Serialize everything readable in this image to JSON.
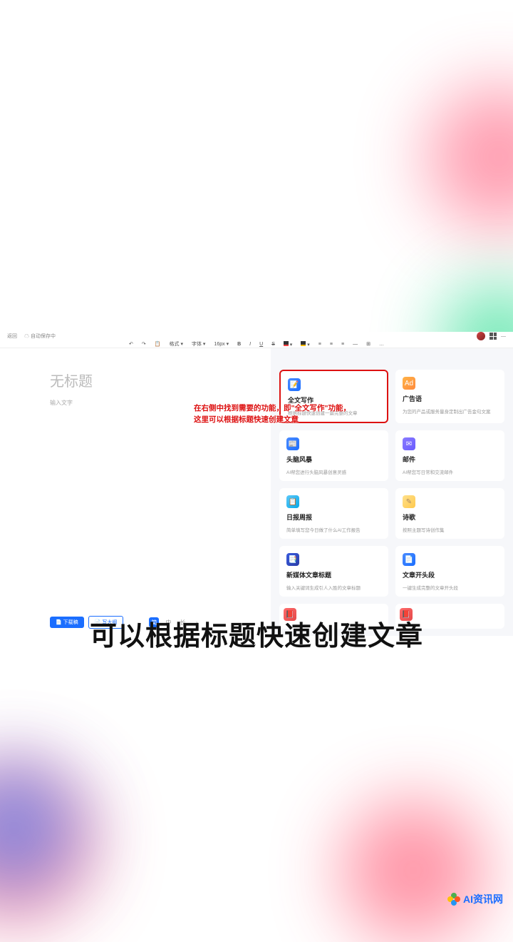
{
  "topbar": {
    "back_label": "返回",
    "autosave_label": "自动保存中"
  },
  "toolbar": {
    "undo": "↶",
    "redo": "↷",
    "paste": "📋",
    "format": "格式",
    "font": "字体",
    "size": "16px",
    "bold": "B",
    "italic": "I",
    "underline": "U",
    "strike": "S",
    "list1": "≡",
    "list2": "≡",
    "list3": "≡",
    "list4": "—",
    "list5": "⊞",
    "list6": "…"
  },
  "doc": {
    "title_placeholder": "无标题",
    "body_placeholder": "输入文字"
  },
  "actions": {
    "btn1": "📄 下载稿",
    "btn2": "📄 写大纲",
    "chip_cn": "简",
    "chip_a": "中",
    "chip_b": "长"
  },
  "panel": {
    "cards": [
      {
        "icon": "📝",
        "cls": "ic-blue",
        "title": "全文写作",
        "desc": "根据标题快速创建一篇完整的文章"
      },
      {
        "icon": "Ad",
        "cls": "ic-orange",
        "title": "广告语",
        "desc": "为您的产品或服务量身定制出广告金句文案"
      },
      {
        "icon": "📰",
        "cls": "ic-blue",
        "title": "头脑风暴",
        "desc": "AI帮您进行头脑风暴创意灵感"
      },
      {
        "icon": "✉",
        "cls": "ic-purple",
        "title": "邮件",
        "desc": "AI帮您写日常和交流邮件"
      },
      {
        "icon": "📋",
        "cls": "ic-cyan",
        "title": "日报周报",
        "desc": "简单填写您今日做了什么AI工作报告"
      },
      {
        "icon": "✎",
        "cls": "ic-yellow",
        "title": "诗歌",
        "desc": "按照主题写诗创作集"
      },
      {
        "icon": "📑",
        "cls": "ic-navy",
        "title": "新媒体文章标题",
        "desc": "输入关键词生成引人入胜的文章标题"
      },
      {
        "icon": "📄",
        "cls": "ic-blue",
        "title": "文章开头段",
        "desc": "一键生成完整的文章开头段"
      }
    ]
  },
  "annotation": {
    "line1": "在右侧中找到需要的功能，即\"全文写作\"功能，",
    "line2": "这里可以根据标题快速创建文章"
  },
  "caption": "可以根据标题快速创建文章",
  "watermark": "AI资讯网"
}
